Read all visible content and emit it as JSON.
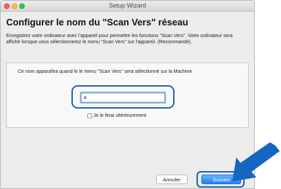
{
  "window": {
    "title": "Setup Wizard"
  },
  "page": {
    "heading": "Configurer le nom du \"Scan Vers\" réseau",
    "description": "Enregistrez votre ordinateur avec l'appareil pour permettre les fonctions \"Scan Vers\". Votre ordinateur sera affiché lorsque vous sélectionnerez le menu \"Scan Vers\" sur l'appareil. (Recommandé)."
  },
  "panel": {
    "instruction": "Ce nom apparaîtra quand le le menu \"Scan Vers\" sera sélectionné sur la Machine",
    "name_value": "a",
    "later_checkbox_label": "Je le ferai ultérieurement",
    "later_checked": false
  },
  "footer": {
    "cancel_label": "Annuler",
    "next_label": "Suivant"
  },
  "colors": {
    "highlight": "#1c5ea8",
    "primary_button": "#1a82fb"
  }
}
